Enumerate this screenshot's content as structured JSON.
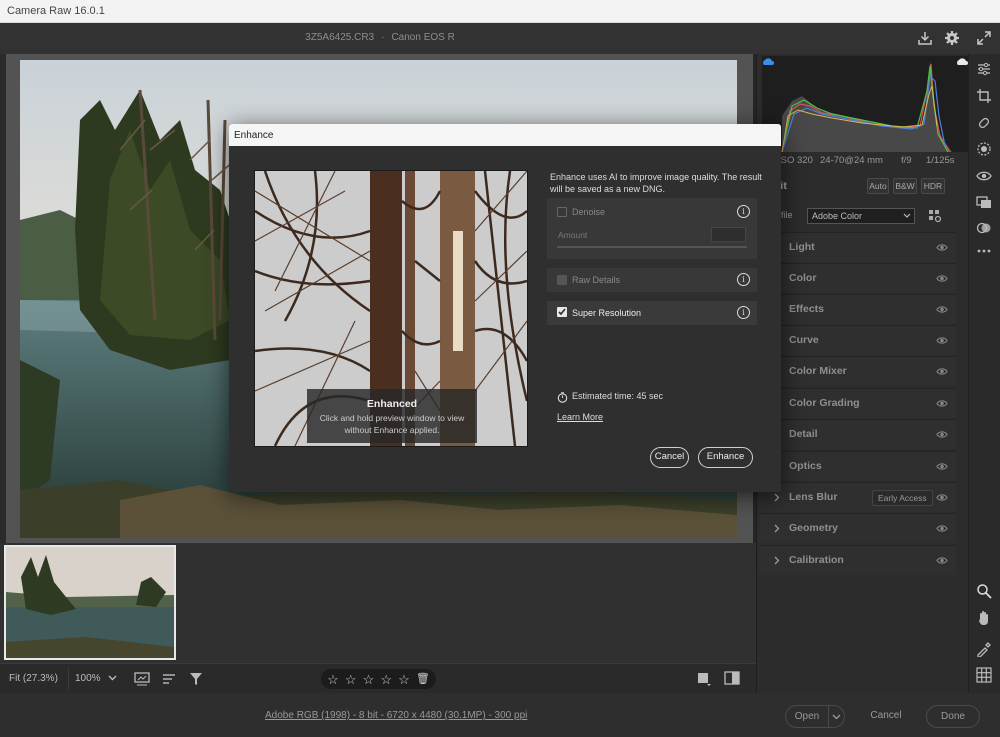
{
  "app": {
    "title": "Camera Raw 16.0.1"
  },
  "header": {
    "filename": "3Z5A6425.CR3",
    "separator": "·",
    "camera": "Canon EOS R"
  },
  "histogram_info": {
    "iso": "ISO 320",
    "lens": "24-70@24 mm",
    "aperture": "f/9",
    "shutter": "1/125s"
  },
  "edit": {
    "label": "Edit",
    "auto": "Auto",
    "bw": "B&W",
    "hdr": "HDR"
  },
  "profile": {
    "label": "Profile",
    "value": "Adobe Color"
  },
  "panels": [
    {
      "label": "Light"
    },
    {
      "label": "Color"
    },
    {
      "label": "Effects"
    },
    {
      "label": "Curve"
    },
    {
      "label": "Color Mixer"
    },
    {
      "label": "Color Grading"
    },
    {
      "label": "Detail"
    },
    {
      "label": "Optics"
    },
    {
      "label": "Lens Blur",
      "badge": "Early Access"
    },
    {
      "label": "Geometry"
    },
    {
      "label": "Calibration"
    }
  ],
  "dialog": {
    "title": "Enhance",
    "description": "Enhance uses AI to improve image quality. The result will be saved as a new DNG.",
    "preview_heading": "Enhanced",
    "preview_hint": "Click and hold preview window to view without Enhance applied.",
    "denoise_label": "Denoise",
    "amount_label": "Amount",
    "raw_details_label": "Raw Details",
    "super_resolution_label": "Super Resolution",
    "super_resolution_checked": true,
    "estimated_time": "Estimated time: 45 sec",
    "learn_more": "Learn More",
    "cancel": "Cancel",
    "enhance": "Enhance"
  },
  "bottom_toolbar": {
    "fit": "Fit (27.3%)",
    "zoom": "100%",
    "rating_stars": 0
  },
  "status_bar": {
    "color_profile": "Adobe RGB (1998) - 8 bit - 6720 x 4480 (30.1MP) - 300 ppi",
    "open": "Open",
    "cancel": "Cancel",
    "done": "Done"
  },
  "colors": {
    "accent": "#1473e6",
    "panel": "#2c2c2c",
    "canvas": "#535353"
  }
}
